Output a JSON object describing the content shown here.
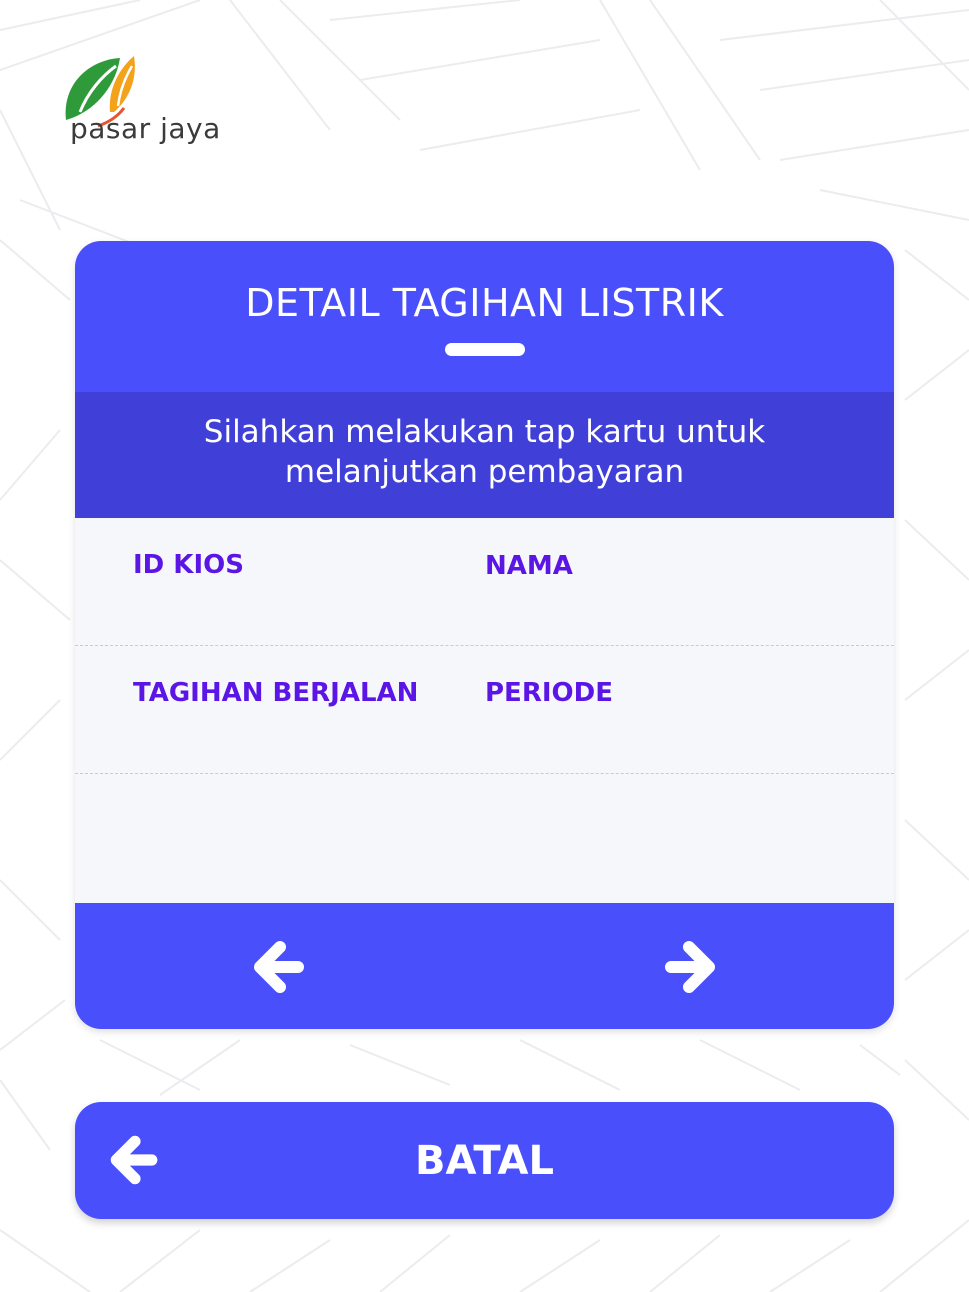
{
  "brand": {
    "name": "pasar jaya",
    "colors": {
      "primary": "#4a4ffc",
      "instruction_bg": "#4040d8",
      "label": "#5b16e6",
      "leaf_green": "#2f9a3a",
      "leaf_orange": "#f2a21b"
    }
  },
  "card": {
    "title": "DETAIL TAGIHAN LISTRIK",
    "instruction_line1": "Silahkan melakukan tap kartu untuk",
    "instruction_line2": "melanjutkan pembayaran",
    "fields": {
      "id_kios_label": "ID KIOS",
      "nama_label": "NAMA",
      "tagihan_label": "TAGIHAN BERJALAN",
      "periode_label": "PERIODE"
    },
    "nav": {
      "prev_icon": "arrow-left-icon",
      "next_icon": "arrow-right-icon"
    }
  },
  "cancel": {
    "label": "BATAL",
    "icon": "arrow-left-icon"
  }
}
